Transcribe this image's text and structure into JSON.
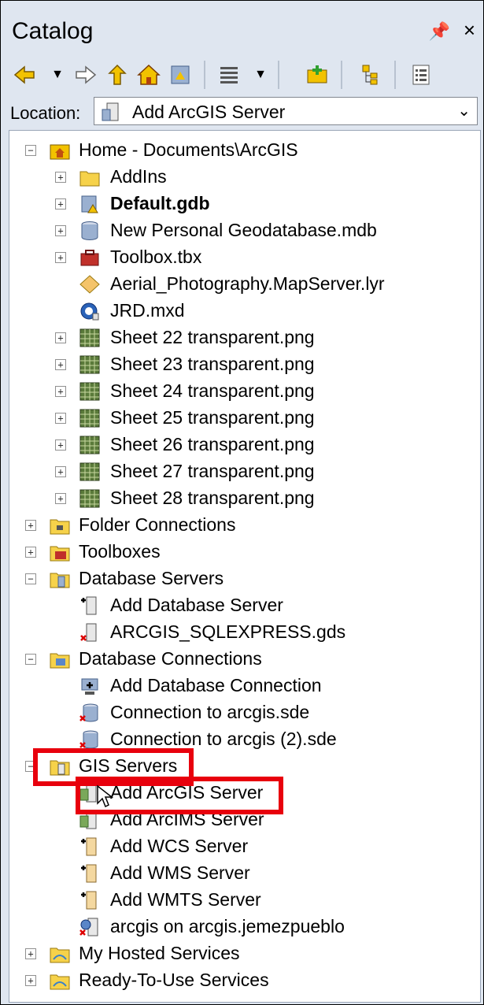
{
  "window": {
    "title": "Catalog",
    "pin_glyph": "Ȩ",
    "close_glyph": "×"
  },
  "toolbar": {
    "icons": [
      "back-arrow-icon",
      "dropdown-arrow-icon",
      "forward-arrow-icon",
      "up-one-level-icon",
      "home-icon",
      "default-gdb-icon",
      "view-icon",
      "dropdown-arrow-icon",
      "connect-folder-icon",
      "toggle-contents-icon",
      "options-icon"
    ]
  },
  "location": {
    "label": "Location:",
    "value": "Add ArcGIS Server"
  },
  "tree": {
    "home": "Home - Documents\\ArcGIS",
    "addins": "AddIns",
    "default_gdb": "Default.gdb",
    "personal_gdb": "New Personal Geodatabase.mdb",
    "toolbox_tbx": "Toolbox.tbx",
    "aerial": "Aerial_Photography.MapServer.lyr",
    "jrd": "JRD.mxd",
    "sheets": [
      "Sheet 22 transparent.png",
      "Sheet 23 transparent.png",
      "Sheet 24 transparent.png",
      "Sheet 25 transparent.png",
      "Sheet 26 transparent.png",
      "Sheet 27 transparent.png",
      "Sheet 28 transparent.png"
    ],
    "folder_connections": "Folder Connections",
    "toolboxes": "Toolboxes",
    "database_servers": "Database Servers",
    "add_db_server": "Add Database Server",
    "arcgis_sqlexpress": "ARCGIS_SQLEXPRESS.gds",
    "database_connections": "Database Connections",
    "add_db_connection": "Add Database Connection",
    "conn1": "Connection to arcgis.sde",
    "conn2": "Connection to arcgis (2).sde",
    "gis_servers": "GIS Servers",
    "add_arcgis_server": "Add ArcGIS Server",
    "add_arcims_server": "Add ArcIMS Server",
    "add_wcs_server": "Add WCS Server",
    "add_wms_server": "Add WMS Server",
    "add_wmts_server": "Add WMTS Server",
    "arcgis_jemez": "arcgis on arcgis.jemezpueblo",
    "my_hosted": "My Hosted Services",
    "ready_to_use": "Ready-To-Use Services"
  },
  "colors": {
    "highlight": "#e8000d",
    "panel": "#dfe6f0"
  }
}
